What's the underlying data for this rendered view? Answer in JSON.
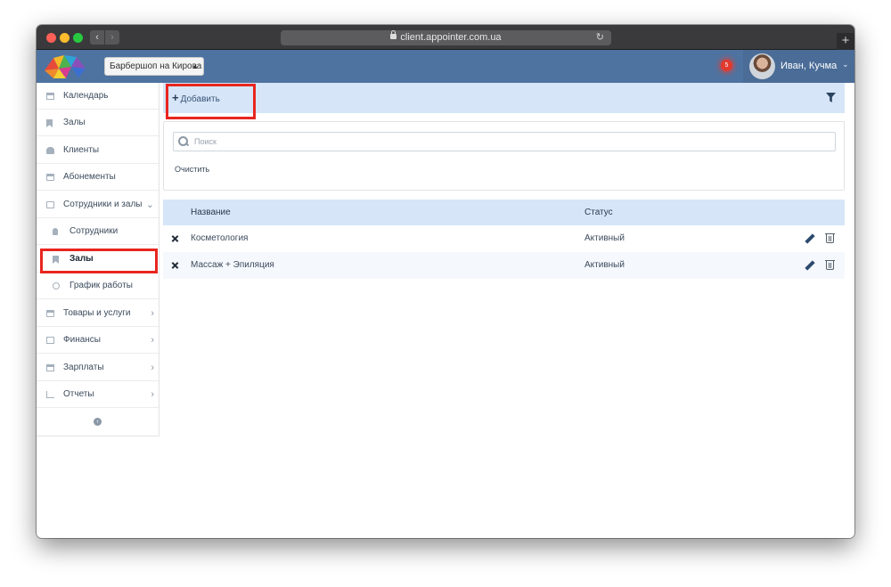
{
  "browser": {
    "url": "client.appointer.com.ua",
    "new_tab": "+"
  },
  "header": {
    "branch": "Барбершоп на Кирова",
    "notifications_count": "5",
    "user_name": "Иван, Кучма"
  },
  "sidebar": {
    "items": [
      {
        "label": "Календарь",
        "icon": "calendar-icon"
      },
      {
        "label": "Залы",
        "icon": "bookmark-icon"
      },
      {
        "label": "Клиенты",
        "icon": "users-icon"
      },
      {
        "label": "Абонементы",
        "icon": "credit-card-icon"
      },
      {
        "label": "Сотрудники и залы",
        "icon": "id-card-icon",
        "expanded": true
      },
      {
        "label": "Сотрудники",
        "icon": "user-icon"
      },
      {
        "label": "Залы",
        "icon": "bookmark-icon",
        "active": true
      },
      {
        "label": "График работы",
        "icon": "clock-icon"
      },
      {
        "label": "Товары и услуги",
        "icon": "credit-card-icon"
      },
      {
        "label": "Финансы",
        "icon": "money-icon"
      },
      {
        "label": "Зарплаты",
        "icon": "calculator-icon"
      },
      {
        "label": "Отчеты",
        "icon": "bar-chart-icon"
      }
    ]
  },
  "toolbar": {
    "add_label": "Добавить"
  },
  "search": {
    "placeholder": "Поиск",
    "clear_label": "Очистить"
  },
  "table": {
    "columns": [
      "Название",
      "Статус"
    ],
    "rows": [
      {
        "name": "Косметология",
        "status": "Активный"
      },
      {
        "name": "Массаж + Эпиляция",
        "status": "Активный"
      }
    ]
  },
  "colors": {
    "header_bg": "#4e73a0",
    "toolbar_bg": "#d6e6f8",
    "highlight": "#e8261f"
  }
}
